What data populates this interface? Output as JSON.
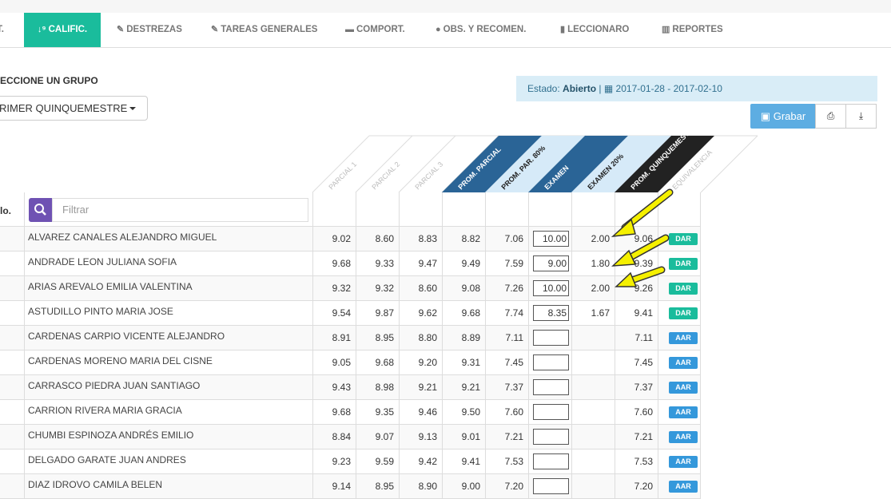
{
  "tabs": [
    {
      "label": "T.",
      "icon": ""
    },
    {
      "label": "CALIFIC.",
      "icon": "sort-numeric-icon"
    },
    {
      "label": "DESTREZAS",
      "icon": "edit-icon"
    },
    {
      "label": "TAREAS GENERALES",
      "icon": "edit-icon"
    },
    {
      "label": "COMPORT.",
      "icon": "comment-box-icon"
    },
    {
      "label": "OBS. Y RECOMEN.",
      "icon": "comments-icon"
    },
    {
      "label": "LECCIONARO",
      "icon": "book-icon"
    },
    {
      "label": "REPORTES",
      "icon": "bar-chart-icon"
    }
  ],
  "group": {
    "label": "ECCIONE UN GRUPO",
    "selected": "RIMER QUINQUEMESTRE"
  },
  "estado": {
    "prefix": "Estado:",
    "value": "Abierto",
    "sep": "|",
    "dates": "2017-01-28 - 2017-02-10"
  },
  "actions": {
    "save_label": "Grabar"
  },
  "columns": [
    "PARCIAL 1",
    "PARCIAL 2",
    "PARCIAL 3",
    "PROM. PARCIAL",
    "PROM. PAR. 80%",
    "EXAMEN",
    "EXAMEN 20%",
    "PROM. QUINQUEMESTRAL",
    "EQUIVALENCIA"
  ],
  "filter": {
    "placeholder": "Filtrar",
    "no_label": "lo."
  },
  "colors": {
    "accent": "#1abc9c",
    "dark_blue": "#2a6496",
    "black": "#222222",
    "light_blue": "#d6eaf8",
    "badge_teal": "#1abc9c",
    "badge_blue": "#3498db"
  },
  "students": [
    {
      "name": "ALVAREZ CANALES ALEJANDRO MIGUEL",
      "p1": "9.02",
      "p2": "8.60",
      "p3": "8.83",
      "prom": "8.82",
      "p80": "7.06",
      "exam": "10.00",
      "e20": "2.00",
      "pq": "9.06",
      "eq": "DAR"
    },
    {
      "name": "ANDRADE LEON JULIANA SOFIA",
      "p1": "9.68",
      "p2": "9.33",
      "p3": "9.47",
      "prom": "9.49",
      "p80": "7.59",
      "exam": "9.00",
      "e20": "1.80",
      "pq": "9.39",
      "eq": "DAR"
    },
    {
      "name": "ARIAS AREVALO EMILIA VALENTINA",
      "p1": "9.32",
      "p2": "9.32",
      "p3": "8.60",
      "prom": "9.08",
      "p80": "7.26",
      "exam": "10.00",
      "e20": "2.00",
      "pq": "9.26",
      "eq": "DAR"
    },
    {
      "name": "ASTUDILLO PINTO MARIA JOSE",
      "p1": "9.54",
      "p2": "9.87",
      "p3": "9.62",
      "prom": "9.68",
      "p80": "7.74",
      "exam": "8.35",
      "e20": "1.67",
      "pq": "9.41",
      "eq": "DAR"
    },
    {
      "name": "CARDENAS CARPIO VICENTE ALEJANDRO",
      "p1": "8.91",
      "p2": "8.95",
      "p3": "8.80",
      "prom": "8.89",
      "p80": "7.11",
      "exam": "",
      "e20": "",
      "pq": "7.11",
      "eq": "AAR"
    },
    {
      "name": "CARDENAS MORENO MARIA DEL CISNE",
      "p1": "9.05",
      "p2": "9.68",
      "p3": "9.20",
      "prom": "9.31",
      "p80": "7.45",
      "exam": "",
      "e20": "",
      "pq": "7.45",
      "eq": "AAR"
    },
    {
      "name": "CARRASCO PIEDRA JUAN SANTIAGO",
      "p1": "9.43",
      "p2": "8.98",
      "p3": "9.21",
      "prom": "9.21",
      "p80": "7.37",
      "exam": "",
      "e20": "",
      "pq": "7.37",
      "eq": "AAR"
    },
    {
      "name": "CARRION RIVERA MARIA GRACIA",
      "p1": "9.68",
      "p2": "9.35",
      "p3": "9.46",
      "prom": "9.50",
      "p80": "7.60",
      "exam": "",
      "e20": "",
      "pq": "7.60",
      "eq": "AAR"
    },
    {
      "name": "CHUMBI ESPINOZA ANDRÉS EMILIO",
      "p1": "8.84",
      "p2": "9.07",
      "p3": "9.13",
      "prom": "9.01",
      "p80": "7.21",
      "exam": "",
      "e20": "",
      "pq": "7.21",
      "eq": "AAR"
    },
    {
      "name": "DELGADO GARATE JUAN ANDRES",
      "p1": "9.23",
      "p2": "9.59",
      "p3": "9.42",
      "prom": "9.41",
      "p80": "7.53",
      "exam": "",
      "e20": "",
      "pq": "7.53",
      "eq": "AAR"
    },
    {
      "name": "DIAZ IDROVO CAMILA BELEN",
      "p1": "9.14",
      "p2": "8.95",
      "p3": "8.90",
      "prom": "9.00",
      "p80": "7.20",
      "exam": "",
      "e20": "",
      "pq": "7.20",
      "eq": "AAR"
    }
  ]
}
